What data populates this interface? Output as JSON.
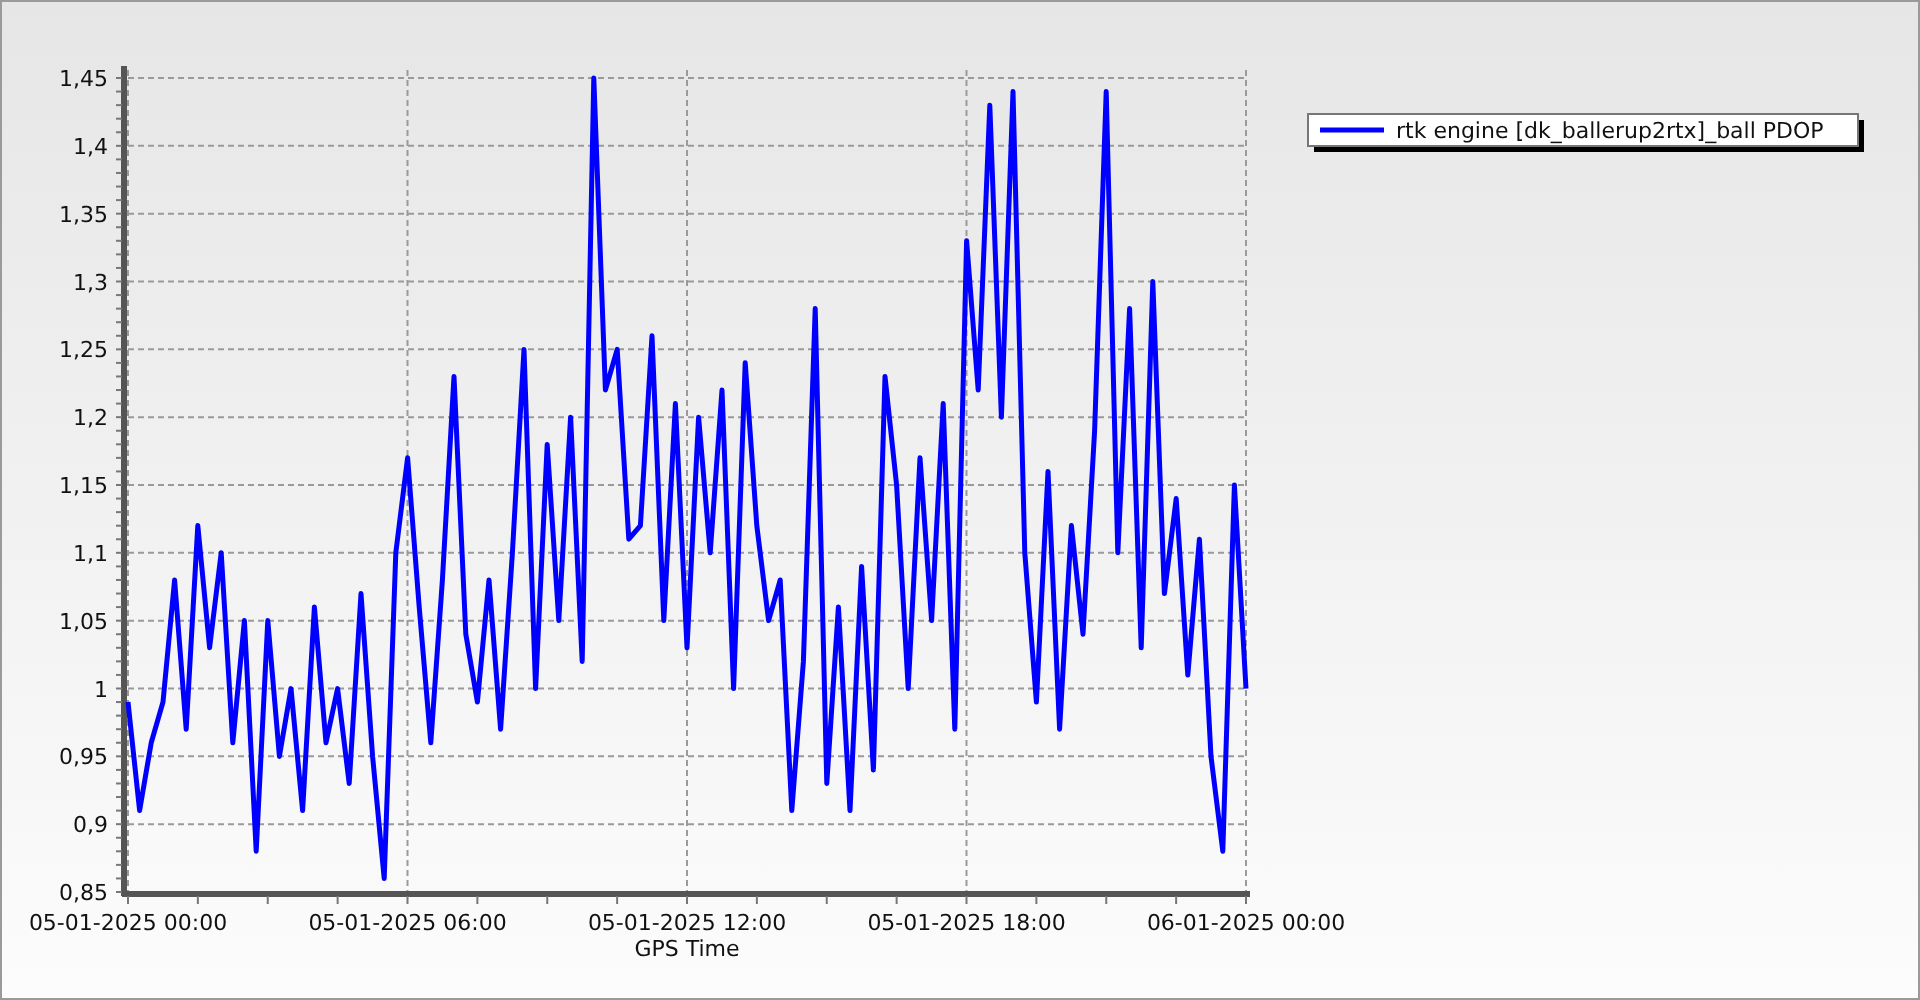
{
  "chart_data": {
    "type": "line",
    "grid": true,
    "xlabel": "GPS Time",
    "categories": [
      "05-01-2025 00:00",
      null,
      null,
      null,
      null,
      null,
      null,
      null,
      null,
      null,
      null,
      null,
      null,
      null,
      null,
      null,
      null,
      null,
      null,
      null,
      null,
      null,
      null,
      null,
      "05-01-2025 06:00",
      null,
      null,
      null,
      null,
      null,
      null,
      null,
      null,
      null,
      null,
      null,
      null,
      null,
      null,
      null,
      null,
      null,
      null,
      null,
      null,
      null,
      null,
      null,
      "05-01-2025 12:00",
      null,
      null,
      null,
      null,
      null,
      null,
      null,
      null,
      null,
      null,
      null,
      null,
      null,
      null,
      null,
      null,
      null,
      null,
      null,
      null,
      null,
      null,
      null,
      "05-01-2025 18:00",
      null,
      null,
      null,
      null,
      null,
      null,
      null,
      null,
      null,
      null,
      null,
      null,
      null,
      null,
      null,
      null,
      null,
      null,
      null,
      null,
      null,
      null,
      null,
      "06-01-2025 00:00"
    ],
    "series": [
      {
        "name": "rtk engine [dk_ballerup2rtx]_ball PDOP",
        "color": "#0000ff",
        "values": [
          0.99,
          0.91,
          0.96,
          0.99,
          1.08,
          0.97,
          1.12,
          1.03,
          1.1,
          0.96,
          1.05,
          0.88,
          1.05,
          0.95,
          1.0,
          0.91,
          1.06,
          0.96,
          1.0,
          0.93,
          1.07,
          0.95,
          0.86,
          1.1,
          1.17,
          1.06,
          0.96,
          1.08,
          1.23,
          1.04,
          0.99,
          1.08,
          0.97,
          1.1,
          1.25,
          1.0,
          1.18,
          1.05,
          1.2,
          1.02,
          1.45,
          1.22,
          1.25,
          1.11,
          1.12,
          1.26,
          1.05,
          1.21,
          1.03,
          1.2,
          1.1,
          1.22,
          1.0,
          1.24,
          1.12,
          1.05,
          1.08,
          0.91,
          1.02,
          1.28,
          0.93,
          1.06,
          0.91,
          1.09,
          0.94,
          1.23,
          1.15,
          1.0,
          1.17,
          1.05,
          1.21,
          0.97,
          1.33,
          1.22,
          1.43,
          1.2,
          1.44,
          1.1,
          0.99,
          1.16,
          0.97,
          1.12,
          1.04,
          1.19,
          1.44,
          1.1,
          1.28,
          1.03,
          1.3,
          1.07,
          1.14,
          1.01,
          1.11,
          0.95,
          0.88,
          1.15,
          1.0
        ]
      }
    ],
    "ylim": [
      0.85,
      1.45
    ],
    "yticks": [
      {
        "value": 0.85,
        "label": "0,85"
      },
      {
        "value": 0.9,
        "label": "0,9"
      },
      {
        "value": 0.95,
        "label": "0,95"
      },
      {
        "value": 1,
        "label": "1"
      },
      {
        "value": 1.05,
        "label": "1,05"
      },
      {
        "value": 1.1,
        "label": "1,1"
      },
      {
        "value": 1.15,
        "label": "1,15"
      },
      {
        "value": 1.2,
        "label": "1,2"
      },
      {
        "value": 1.25,
        "label": "1,25"
      },
      {
        "value": 1.3,
        "label": "1,3"
      },
      {
        "value": 1.35,
        "label": "1,35"
      },
      {
        "value": 1.4,
        "label": "1,4"
      },
      {
        "value": 1.45,
        "label": "1,45"
      }
    ]
  }
}
